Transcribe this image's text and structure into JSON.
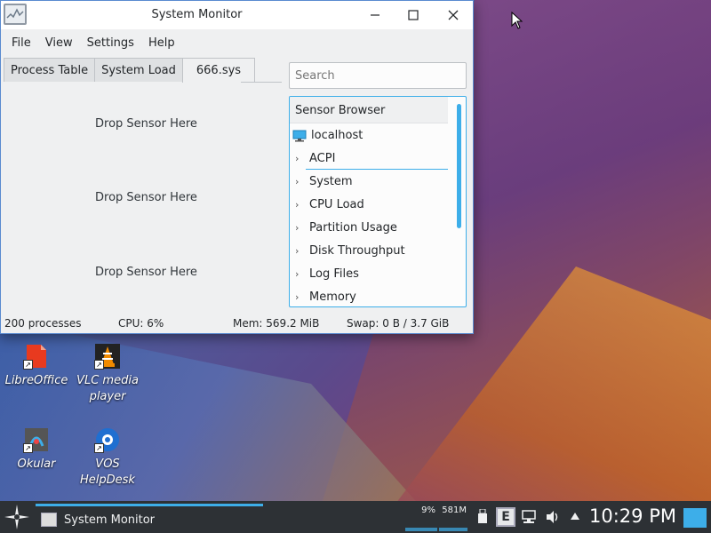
{
  "window": {
    "title": "System Monitor",
    "menu": [
      "File",
      "View",
      "Settings",
      "Help"
    ],
    "tabs": [
      "Process Table",
      "System Load",
      "666.sys"
    ],
    "drop_label": "Drop Sensor Here",
    "search_placeholder": "Search",
    "sensor_browser": {
      "header": "Sensor Browser",
      "host": "localhost",
      "items": [
        "ACPI",
        "System",
        "CPU Load",
        "Partition Usage",
        "Disk Throughput",
        "Log Files",
        "Memory"
      ]
    },
    "status": {
      "processes": "200 processes",
      "cpu": "CPU: 6%",
      "mem": "Mem: 569.2 MiB",
      "swap": "Swap: 0 B / 3.7 GiB"
    }
  },
  "desktop_icons": [
    {
      "label": "LibreOffice",
      "icon": "libreoffice-icon"
    },
    {
      "label": "VLC media player",
      "icon": "vlc-icon"
    },
    {
      "label": "Okular",
      "icon": "okular-icon"
    },
    {
      "label": "VOS HelpDesk",
      "icon": "helpdesk-icon"
    }
  ],
  "taskbar": {
    "task_label": "System Monitor",
    "cpu_percent": "9%",
    "memory": "581M",
    "clock": "10:29 PM"
  },
  "colors": {
    "accent": "#3daee9",
    "taskbar": "#2d3135",
    "window_bg": "#eff0f1"
  }
}
